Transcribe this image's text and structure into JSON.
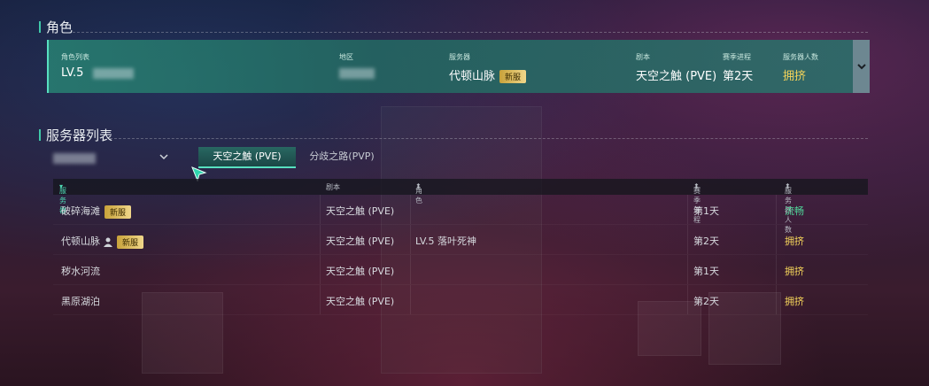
{
  "role_section": {
    "title": "角色",
    "role_list_label": "角色列表",
    "role_level": "LV.5",
    "region_label": "地区",
    "server_label": "服务器",
    "server_value": "代顿山脉",
    "server_badge": "新服",
    "script_label": "剧本",
    "script_value": "天空之触 (PVE)",
    "season_label": "赛季进程",
    "season_value": "第2天",
    "population_label": "服务器人数",
    "population_value": "拥挤"
  },
  "server_section": {
    "title": "服务器列表",
    "tabs": [
      {
        "label": "天空之触 (PVE)",
        "active": true
      },
      {
        "label": "分歧之路(PVP)",
        "active": false
      }
    ],
    "columns": {
      "server": "服务器",
      "script": "剧本",
      "role": "角色",
      "season": "赛季进程",
      "population": "服务器人数"
    },
    "rows": [
      {
        "server": "破碎海滩",
        "badge": "新服",
        "script": "天空之触 (PVE)",
        "role": "",
        "season": "第1天",
        "population": "流畅",
        "status": "smooth"
      },
      {
        "server": "代顿山脉",
        "badge": "新服",
        "script": "天空之触 (PVE)",
        "role": "LV.5 落叶死神",
        "season": "第2天",
        "population": "拥挤",
        "status": "crowded",
        "has_role": true
      },
      {
        "server": "秽水河流",
        "badge": "",
        "script": "天空之触 (PVE)",
        "role": "",
        "season": "第1天",
        "population": "拥挤",
        "status": "crowded"
      },
      {
        "server": "黑原湖泊",
        "badge": "",
        "script": "天空之触 (PVE)",
        "role": "",
        "season": "第2天",
        "population": "拥挤",
        "status": "crowded"
      }
    ]
  },
  "colors": {
    "accent": "#3fc8a8",
    "crowded": "#f3d35a",
    "smooth": "#4fd79a"
  }
}
